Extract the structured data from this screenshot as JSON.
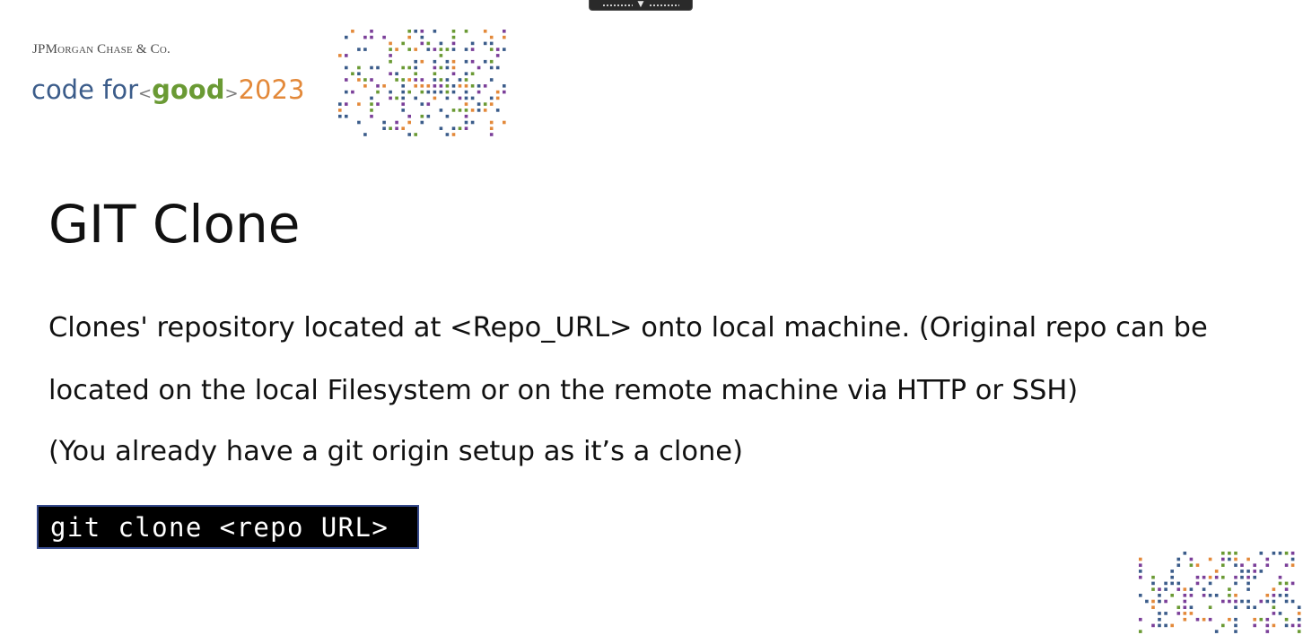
{
  "header": {
    "brand": "JPMorgan Chase & Co.",
    "event": {
      "prefix": "code for",
      "open_bracket": "<",
      "keyword": "good",
      "close_bracket": ">",
      "year": "2023"
    }
  },
  "slide": {
    "title": "GIT Clone",
    "paragraphs": [
      "Clones' repository located at <Repo_URL> onto local machine. (Original repo can be",
      "located on the local Filesystem or on the remote machine via HTTP or SSH)",
      "(You already have a git origin setup as it’s a clone)"
    ],
    "command": "git clone <repo URL>"
  },
  "colors": {
    "brand_blue": "#3b5c8a",
    "brand_green": "#6a9a34",
    "brand_orange": "#e3893a",
    "brand_purple": "#7b3f99",
    "command_bg": "#000000",
    "command_border": "#34488a"
  }
}
